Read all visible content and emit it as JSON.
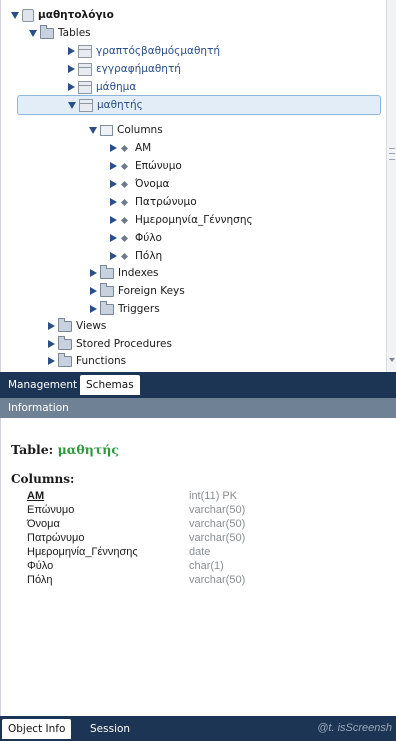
{
  "tree": {
    "schema": "μαθητολόγιο",
    "tables_folder": "Tables",
    "tables": [
      "γραπτόςβαθμόςμαθητή",
      "εγγραφήμαθητή",
      "μάθημα",
      "μαθητής"
    ],
    "columns_folder": "Columns",
    "columns": [
      "ΑΜ",
      "Επώνυμο",
      "Όνομα",
      "Πατρώνυμο",
      "Ημερομηνία_Γέννησης",
      "Φύλο",
      "Πόλη"
    ],
    "indexes_folder": "Indexes",
    "foreign_keys_folder": "Foreign Keys",
    "triggers_folder": "Triggers",
    "views_folder": "Views",
    "stored_procedures_folder": "Stored Procedures",
    "functions_folder": "Functions"
  },
  "tabs_top": {
    "management": "Management",
    "schemas": "Schemas"
  },
  "info_panel": {
    "header": "Information",
    "table_prefix": "Table:",
    "table_name": "μαθητής",
    "columns_heading": "Columns:",
    "columns": [
      {
        "name": "ΑΜ",
        "type": "int(11) PK"
      },
      {
        "name": "Επώνυμο",
        "type": "varchar(50)"
      },
      {
        "name": "Όνομα",
        "type": "varchar(50)"
      },
      {
        "name": "Πατρώνυμο",
        "type": "varchar(50)"
      },
      {
        "name": "Ημερομηνία_Γέννησης",
        "type": "date"
      },
      {
        "name": "Φύλο",
        "type": "char(1)"
      },
      {
        "name": "Πόλη",
        "type": "varchar(50)"
      }
    ]
  },
  "tabs_bottom": {
    "object_info": "Object Info",
    "session": "Session"
  },
  "watermark": "@t. isScreensh",
  "colors": {
    "tab_bar": "#1d3554",
    "info_header": "#6f8195",
    "selection": "#e3edf8",
    "table_name": "#2d9a3d",
    "type_text": "#8a8e93"
  },
  "icons": {
    "expanded": "triangle-down-icon",
    "collapsed": "triangle-right-icon",
    "schema": "database-icon",
    "folder": "folder-icon",
    "table": "table-icon",
    "column": "column-diamond-icon"
  }
}
